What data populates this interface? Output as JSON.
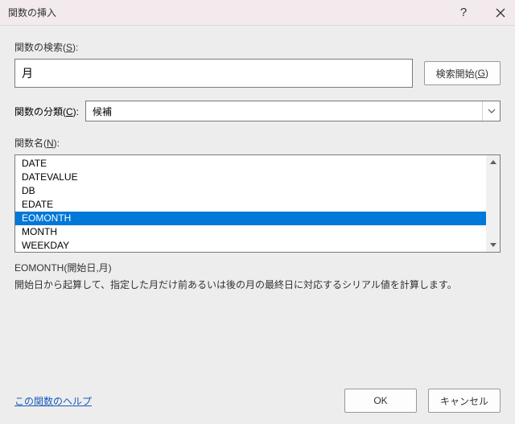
{
  "titlebar": {
    "title": "関数の挿入"
  },
  "search": {
    "label_prefix": "関数の検索(",
    "label_key": "S",
    "label_suffix": "):",
    "value": "月",
    "button_prefix": "検索開始(",
    "button_key": "G",
    "button_suffix": ")"
  },
  "category": {
    "label_prefix": "関数の分類(",
    "label_key": "C",
    "label_suffix": "):",
    "selected": "候補"
  },
  "functions": {
    "label_prefix": "関数名(",
    "label_key": "N",
    "label_suffix": "):",
    "items": [
      {
        "name": "DATE",
        "selected": false
      },
      {
        "name": "DATEVALUE",
        "selected": false
      },
      {
        "name": "DB",
        "selected": false
      },
      {
        "name": "EDATE",
        "selected": false
      },
      {
        "name": "EOMONTH",
        "selected": true
      },
      {
        "name": "MONTH",
        "selected": false
      },
      {
        "name": "WEEKDAY",
        "selected": false
      }
    ]
  },
  "preview": {
    "syntax": "EOMONTH(開始日,月)",
    "description": "開始日から起算して、指定した月だけ前あるいは後の月の最終日に対応するシリアル値を計算します。"
  },
  "footer": {
    "help_link": "この関数のヘルプ",
    "ok": "OK",
    "cancel": "キャンセル"
  }
}
